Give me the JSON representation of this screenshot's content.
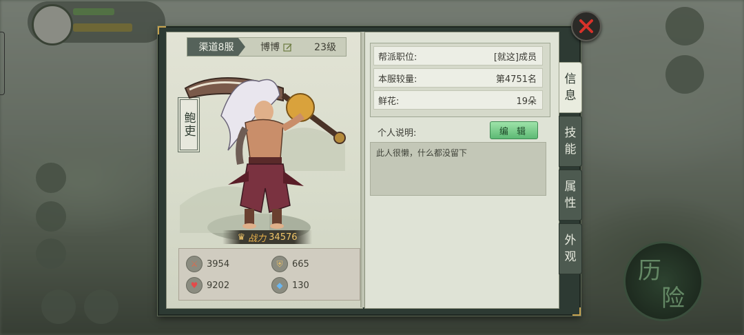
{
  "player": {
    "server": "渠道8服",
    "name": "博博",
    "level": "23级",
    "seal": "鲍吏"
  },
  "power": {
    "label": "战力",
    "value": "34576"
  },
  "stats": [
    {
      "icon": "attack-icon",
      "value": "3954"
    },
    {
      "icon": "defense-icon",
      "value": "665"
    },
    {
      "icon": "health-icon",
      "value": "9202"
    },
    {
      "icon": "gem-icon",
      "value": "130"
    }
  ],
  "info": {
    "rows": [
      {
        "key": "帮派职位:",
        "value": "[就这]成员"
      },
      {
        "key": "本服较量:",
        "value": "第4751名"
      },
      {
        "key": "鲜花:",
        "value": "19朵"
      }
    ],
    "desc_label": "个人说明:",
    "edit_label": "编 辑",
    "description": "此人很懒，什么都没留下"
  },
  "tabs": [
    {
      "label_top": "信",
      "label_bottom": "息",
      "active": true
    },
    {
      "label_top": "技",
      "label_bottom": "能",
      "active": false
    },
    {
      "label_top": "属",
      "label_bottom": "性",
      "active": false
    },
    {
      "label_top": "外",
      "label_bottom": "观",
      "active": false
    }
  ],
  "background": {
    "adventure_char_1": "历",
    "adventure_char_2": "险"
  },
  "colors": {
    "accent_green": "#5db974",
    "power_gold": "#f1c66a",
    "panel_dark": "#2d3a33",
    "close_red": "#d8322a"
  }
}
